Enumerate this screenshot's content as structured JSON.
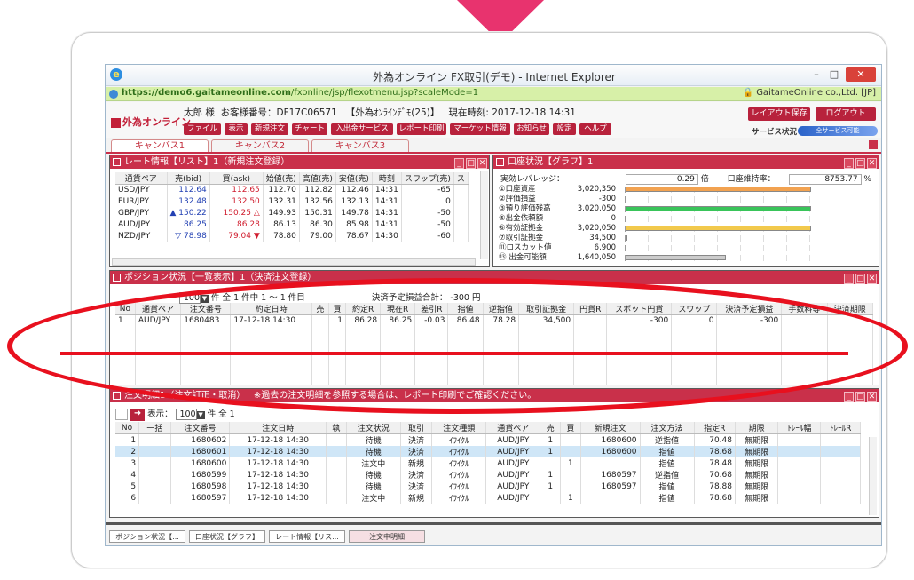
{
  "window": {
    "title": "外為オンライン FX取引(デモ) - Internet Explorer",
    "url_domain": "https://demo6.gaitameonline.com",
    "url_path": "/fxonline/jsp/flexotmenu.jsp?scaleMode=1",
    "site_owner": "GaitameOnline co.,Ltd. [JP]",
    "minimize": "–",
    "maximize": "□",
    "close": "✕"
  },
  "app": {
    "logo": "外為オンライン",
    "user": "太郎 様",
    "account_label": "お客様番号：DF17C06571",
    "mode": "【外為ｵﾝﾗｲﾝﾃﾞﾓ(25)】",
    "time_label": "現在時刻:",
    "time": "2017-12-18 14:31",
    "menu": [
      "ファイル",
      "表示",
      "新規注文",
      "チャート",
      "入出金サービス",
      "レポート印刷",
      "マーケット情報",
      "お知らせ",
      "設定",
      "ヘルプ"
    ],
    "layout_save": "レイアウト保存",
    "logout": "ログアウト",
    "service_label": "サービス状況",
    "service_status": "全サービス可能"
  },
  "canvas_tabs": [
    "キャンバス1",
    "キャンバス2",
    "キャンバス3"
  ],
  "rates": {
    "title": "レート情報【リスト】1（新規注文登録）",
    "headers": [
      "通貨ペア",
      "売(bid)",
      "買(ask)",
      "始値(売)",
      "高値(売)",
      "安値(売)",
      "時刻",
      "スワップ(売)",
      "ス"
    ],
    "rows": [
      [
        "USD/JPY",
        "",
        "112.64",
        "112.65",
        "",
        "112.70",
        "112.82",
        "112.46",
        "14:31",
        "-65"
      ],
      [
        "EUR/JPY",
        "",
        "132.48",
        "132.50",
        "",
        "132.31",
        "132.56",
        "132.13",
        "14:31",
        "0"
      ],
      [
        "GBP/JPY",
        "▲",
        "150.22",
        "150.25",
        "△",
        "149.93",
        "150.31",
        "149.78",
        "14:31",
        "-50"
      ],
      [
        "AUD/JPY",
        "",
        "86.25",
        "86.28",
        "",
        "86.13",
        "86.30",
        "85.98",
        "14:31",
        "-50"
      ],
      [
        "NZD/JPY",
        "▽",
        "78.98",
        "79.04",
        "▼",
        "78.80",
        "79.00",
        "78.67",
        "14:30",
        "-60"
      ]
    ]
  },
  "account": {
    "title": "口座状況【グラフ】1",
    "leverage_label": "実効レバレッジ：",
    "leverage": "0.29",
    "leverage_unit": "倍",
    "ratio_label": "口座維持率：",
    "ratio": "8753.77",
    "ratio_unit": "%",
    "items": [
      [
        "①口座資産",
        "3,020,350"
      ],
      [
        "②評価損益",
        "-300"
      ],
      [
        "③預り評価残高",
        "3,020,050"
      ],
      [
        "⑤出金依頼額",
        "0"
      ],
      [
        "⑥有効証拠金",
        "3,020,050"
      ],
      [
        "⑦取引証拠金",
        "34,500"
      ],
      [
        "⑪ロスカット値",
        "6,900"
      ],
      [
        "⑬ 出金可能額",
        "1,640,050"
      ]
    ],
    "bar_colors": [
      "#f2a250",
      "",
      "#39c45a",
      "",
      "#f2c94c",
      "",
      "",
      ""
    ],
    "bar_fill": [
      0.98,
      0,
      0.98,
      0,
      0.98,
      0.01,
      0,
      0.53
    ]
  },
  "positions": {
    "title": "ポジション状況【一覧表示】1（決済注文登録）",
    "display_count": "100",
    "summary": "件 全 1 件中 1 ～ 1 件目",
    "pl_label": "決済予定損益合計：",
    "pl_value": "-300 円",
    "headers": [
      "No",
      "通貨ペア",
      "注文番号",
      "約定日時",
      "売",
      "買",
      "約定R",
      "現在R",
      "差引R",
      "指値",
      "逆指値",
      "取引証拠金",
      "円貨R",
      "スポット円貨",
      "スワップ",
      "決済予定損益",
      "手数料等",
      "決済期限"
    ],
    "rows": [
      [
        "1",
        "AUD/JPY",
        "1680483",
        "17-12-18 14:30",
        "",
        "1",
        "86.28",
        "86.25",
        "-0.03",
        "86.48",
        "78.28",
        "34,500",
        "",
        "-300",
        "0",
        "-300",
        "",
        ""
      ]
    ]
  },
  "orders": {
    "title": "注文明細1（注文訂正・取消）",
    "notice": "※過去の注文明細を参照する場合は、レポート印刷でご確認ください。",
    "display_label": "表示：",
    "display_count": "100",
    "summary": "件 全 1",
    "go": "➜",
    "headers": [
      "No",
      "一括",
      "注文番号",
      "注文日時",
      "執",
      "注文状況",
      "取引",
      "注文種類",
      "通貨ペア",
      "売",
      "買",
      "新規注文",
      "注文方法",
      "指定R",
      "期限",
      "ﾄﾚｰﾙ幅",
      "ﾄﾚｰﾙR"
    ],
    "rows": [
      [
        "1",
        "",
        "1680602",
        "17-12-18 14:30",
        "",
        "待機",
        "決済",
        "ｲﾌｲｸﾙ",
        "AUD/JPY",
        "1",
        "",
        "1680600",
        "逆指値",
        "70.48",
        "無期限",
        "",
        ""
      ],
      [
        "2",
        "",
        "1680601",
        "17-12-18 14:30",
        "",
        "待機",
        "決済",
        "ｲﾌｲｸﾙ",
        "AUD/JPY",
        "1",
        "",
        "1680600",
        "指値",
        "78.68",
        "無期限",
        "",
        ""
      ],
      [
        "3",
        "",
        "1680600",
        "17-12-18 14:30",
        "",
        "注文中",
        "新規",
        "ｲﾌｲｸﾙ",
        "AUD/JPY",
        "",
        "1",
        "",
        "指値",
        "78.48",
        "無期限",
        "",
        ""
      ],
      [
        "4",
        "",
        "1680599",
        "17-12-18 14:30",
        "",
        "待機",
        "決済",
        "ｲﾌｲｸﾙ",
        "AUD/JPY",
        "1",
        "",
        "1680597",
        "逆指値",
        "70.68",
        "無期限",
        "",
        ""
      ],
      [
        "5",
        "",
        "1680598",
        "17-12-18 14:30",
        "",
        "待機",
        "決済",
        "ｲﾌｲｸﾙ",
        "AUD/JPY",
        "1",
        "",
        "1680597",
        "指値",
        "78.88",
        "無期限",
        "",
        ""
      ],
      [
        "6",
        "",
        "1680597",
        "17-12-18 14:30",
        "",
        "注文中",
        "新規",
        "ｲﾌｲｸﾙ",
        "AUD/JPY",
        "",
        "1",
        "",
        "指値",
        "78.68",
        "無期限",
        "",
        ""
      ]
    ]
  },
  "bottom_tabs": [
    "ポジション状況【...",
    "口座状況【グラフ】",
    "レート情報【リス...",
    "注文中明細"
  ]
}
